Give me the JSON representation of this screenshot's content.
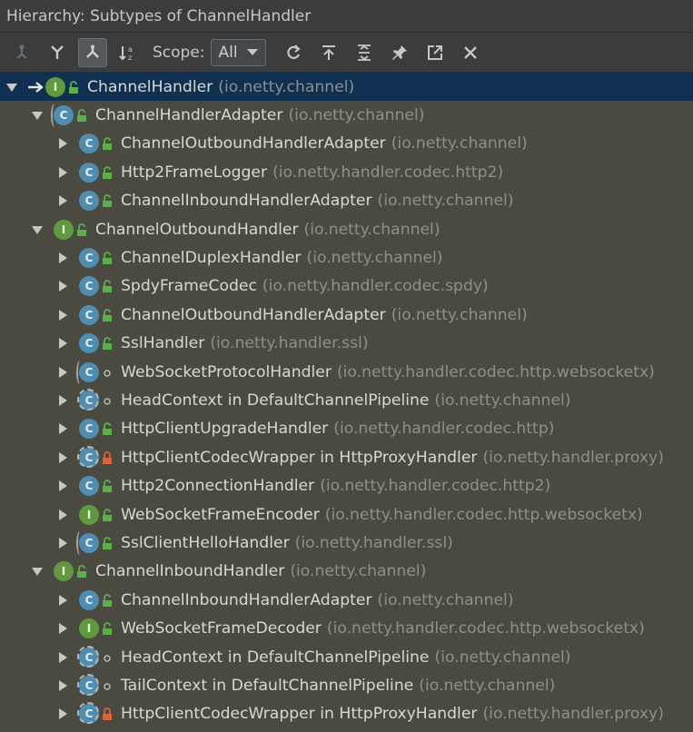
{
  "title": "Hierarchy:  Subtypes of ChannelHandler",
  "toolbar": {
    "scope_label": "Scope:",
    "scope_value": "All"
  },
  "tree": [
    {
      "depth": 0,
      "expand": "open",
      "kind": "i",
      "mod": "public",
      "name": "ChannelHandler",
      "pkg": "(io.netty.channel)",
      "selected": true,
      "root": true
    },
    {
      "depth": 1,
      "expand": "open",
      "kind": "abs",
      "mod": "public",
      "name": "ChannelHandlerAdapter",
      "pkg": "(io.netty.channel)"
    },
    {
      "depth": 2,
      "expand": "closed",
      "kind": "c",
      "mod": "public",
      "name": "ChannelOutboundHandlerAdapter",
      "pkg": "(io.netty.channel)"
    },
    {
      "depth": 2,
      "expand": "closed",
      "kind": "c",
      "mod": "public",
      "name": "Http2FrameLogger",
      "pkg": "(io.netty.handler.codec.http2)"
    },
    {
      "depth": 2,
      "expand": "closed",
      "kind": "c",
      "mod": "public",
      "name": "ChannelInboundHandlerAdapter",
      "pkg": "(io.netty.channel)"
    },
    {
      "depth": 1,
      "expand": "open",
      "kind": "i",
      "mod": "public",
      "name": "ChannelOutboundHandler",
      "pkg": "(io.netty.channel)"
    },
    {
      "depth": 2,
      "expand": "closed",
      "kind": "c",
      "mod": "public",
      "name": "ChannelDuplexHandler",
      "pkg": "(io.netty.channel)"
    },
    {
      "depth": 2,
      "expand": "closed",
      "kind": "c",
      "mod": "public",
      "name": "SpdyFrameCodec",
      "pkg": "(io.netty.handler.codec.spdy)"
    },
    {
      "depth": 2,
      "expand": "closed",
      "kind": "c",
      "mod": "public",
      "name": "ChannelOutboundHandlerAdapter",
      "pkg": "(io.netty.channel)"
    },
    {
      "depth": 2,
      "expand": "closed",
      "kind": "c",
      "mod": "public",
      "name": "SslHandler",
      "pkg": "(io.netty.handler.ssl)"
    },
    {
      "depth": 2,
      "expand": "closed",
      "kind": "abs",
      "mod": "package",
      "name": "WebSocketProtocolHandler",
      "pkg": "(io.netty.handler.codec.http.websocketx)"
    },
    {
      "depth": 2,
      "expand": "closed",
      "kind": "anon",
      "mod": "package",
      "name": "HeadContext in DefaultChannelPipeline",
      "pkg": "(io.netty.channel)"
    },
    {
      "depth": 2,
      "expand": "closed",
      "kind": "c",
      "mod": "public",
      "name": "HttpClientUpgradeHandler",
      "pkg": "(io.netty.handler.codec.http)"
    },
    {
      "depth": 2,
      "expand": "closed",
      "kind": "anon",
      "mod": "private",
      "name": "HttpClientCodecWrapper in HttpProxyHandler",
      "pkg": "(io.netty.handler.proxy)"
    },
    {
      "depth": 2,
      "expand": "closed",
      "kind": "c",
      "mod": "public",
      "name": "Http2ConnectionHandler",
      "pkg": "(io.netty.handler.codec.http2)"
    },
    {
      "depth": 2,
      "expand": "closed",
      "kind": "i",
      "mod": "public",
      "name": "WebSocketFrameEncoder",
      "pkg": "(io.netty.handler.codec.http.websocketx)"
    },
    {
      "depth": 2,
      "expand": "closed",
      "kind": "abs",
      "mod": "public",
      "name": "SslClientHelloHandler",
      "pkg": "(io.netty.handler.ssl)"
    },
    {
      "depth": 1,
      "expand": "open",
      "kind": "i",
      "mod": "public",
      "name": "ChannelInboundHandler",
      "pkg": "(io.netty.channel)"
    },
    {
      "depth": 2,
      "expand": "closed",
      "kind": "c",
      "mod": "public",
      "name": "ChannelInboundHandlerAdapter",
      "pkg": "(io.netty.channel)"
    },
    {
      "depth": 2,
      "expand": "closed",
      "kind": "i",
      "mod": "public",
      "name": "WebSocketFrameDecoder",
      "pkg": "(io.netty.handler.codec.http.websocketx)"
    },
    {
      "depth": 2,
      "expand": "closed",
      "kind": "anon",
      "mod": "package",
      "name": "HeadContext in DefaultChannelPipeline",
      "pkg": "(io.netty.channel)"
    },
    {
      "depth": 2,
      "expand": "closed",
      "kind": "anon",
      "mod": "package",
      "name": "TailContext in DefaultChannelPipeline",
      "pkg": "(io.netty.channel)"
    },
    {
      "depth": 2,
      "expand": "closed",
      "kind": "anon",
      "mod": "private",
      "name": "HttpClientCodecWrapper in HttpProxyHandler",
      "pkg": "(io.netty.handler.proxy)"
    }
  ],
  "icons": {
    "kind_letters": {
      "c": "C",
      "i": "I",
      "abs": "C",
      "anon": "C"
    },
    "colors": {
      "class": "#4f8eb1",
      "interface": "#5f9b3e",
      "public": "#5bb04a",
      "private": "#d8643a",
      "selected_row": "#0f3050"
    }
  }
}
